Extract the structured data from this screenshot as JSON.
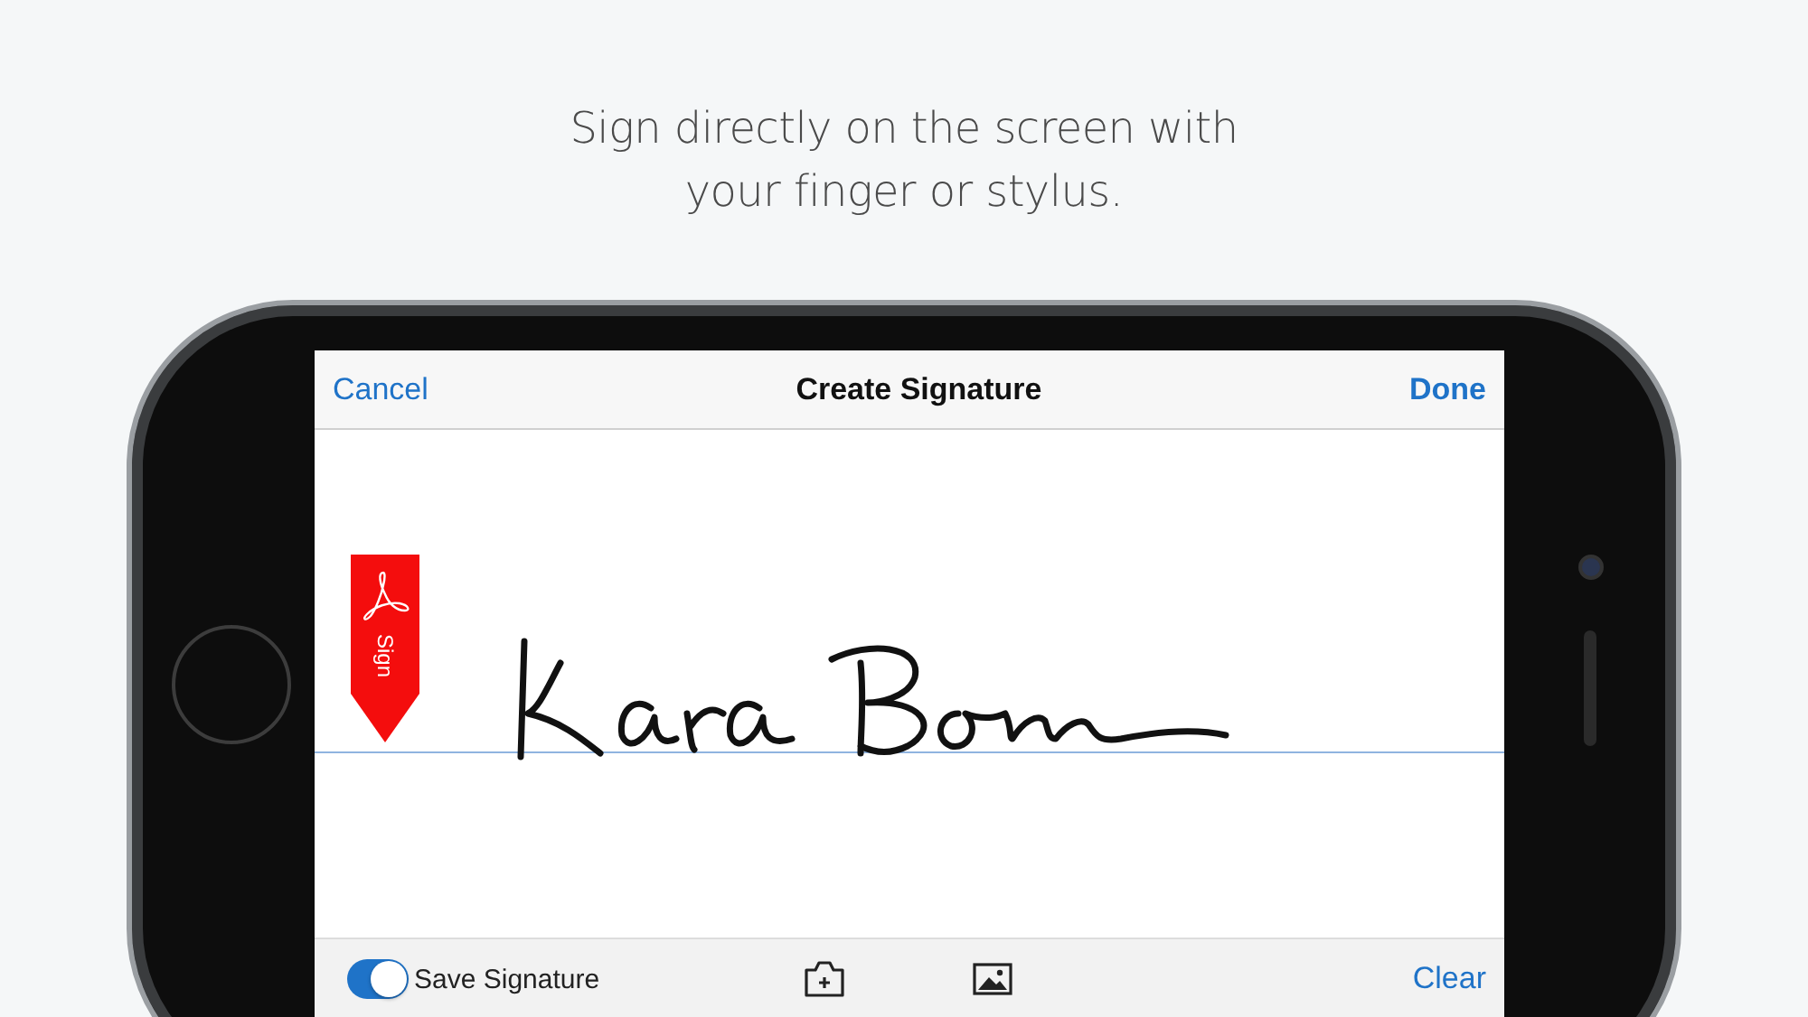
{
  "headline": "Sign directly on the screen with\nyour finger or stylus.",
  "nav": {
    "cancel": "Cancel",
    "title": "Create Signature",
    "done": "Done"
  },
  "sign_tab": {
    "label": "Sign"
  },
  "toolbar": {
    "save_signature": {
      "label": "Save Signature",
      "on": true
    },
    "clear": "Clear"
  }
}
